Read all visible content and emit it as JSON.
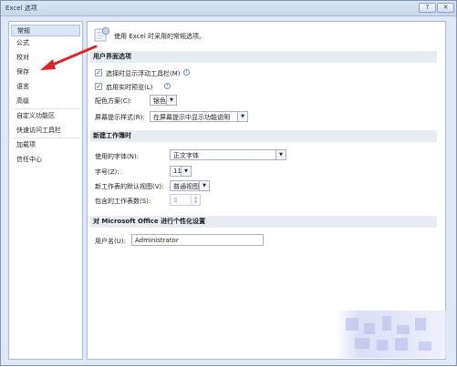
{
  "window": {
    "title": "Excel 选项",
    "help_label": "?",
    "close_label": "✕"
  },
  "sidebar": {
    "items": [
      {
        "label": "常规"
      },
      {
        "label": "公式"
      },
      {
        "label": "校对"
      },
      {
        "label": "保存"
      },
      {
        "label": "语言"
      },
      {
        "label": "高级"
      },
      {
        "label": "自定义功能区"
      },
      {
        "label": "快速访问工具栏"
      },
      {
        "label": "加载项"
      },
      {
        "label": "信任中心"
      }
    ],
    "active_index": 0
  },
  "intro": {
    "text": "使用 Excel 时采用的常规选项。",
    "icon": "settings-gear-icon"
  },
  "ui_section": {
    "header": "用户界面选项",
    "mini_toolbar": {
      "label": "选择时显示浮动工具栏(M)",
      "checked": true
    },
    "live_preview": {
      "label": "启用实时预览(L)",
      "checked": true
    },
    "color_scheme": {
      "label": "配色方案(C):",
      "value": "银色"
    },
    "screentip": {
      "label": "屏幕提示样式(R):",
      "value": "在屏幕提示中显示功能说明"
    }
  },
  "workbook_section": {
    "header": "新建工作簿时",
    "font": {
      "label": "使用的字体(N):",
      "value": "正文字体"
    },
    "size": {
      "label": "字号(Z):",
      "value": "11"
    },
    "default_view": {
      "label": "新工作表的默认视图(V):",
      "value": "普通视图"
    },
    "sheet_count": {
      "label": "包含的工作表数(S):",
      "value": "3"
    }
  },
  "personalize_section": {
    "header": "对 Microsoft Office 进行个性化设置",
    "username": {
      "label": "用户名(U):",
      "value": "Administrator"
    }
  },
  "annotation": {
    "color": "#e0242a",
    "type": "red-arrow"
  },
  "colors": {
    "accent": "#dbe6f5",
    "title_text": "#1e395b"
  }
}
